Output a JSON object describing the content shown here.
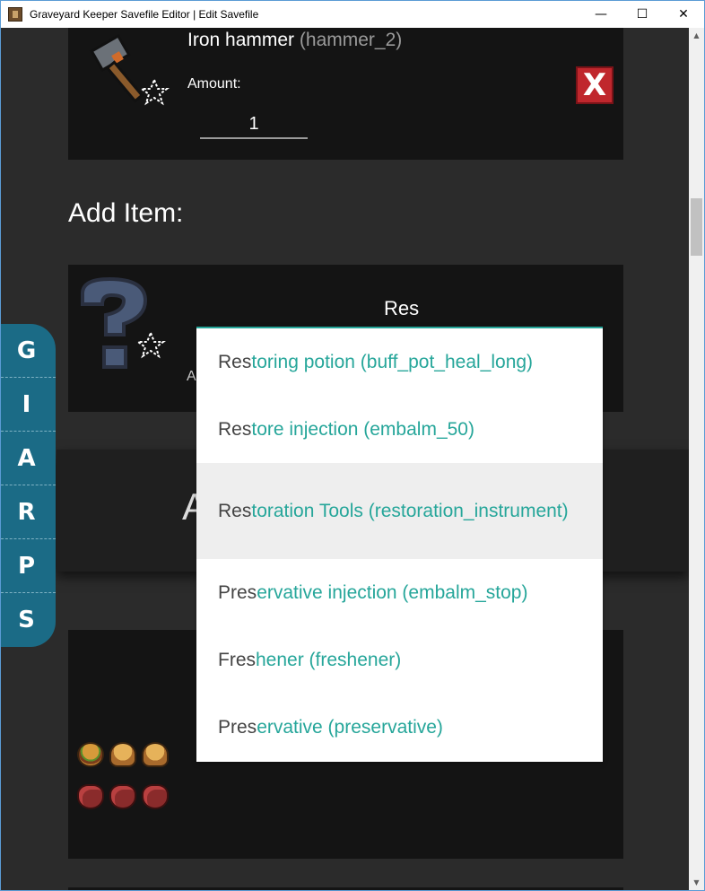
{
  "window": {
    "title": "Graveyard Keeper Savefile Editor | Edit Savefile",
    "controls": {
      "minimize": "—",
      "maximize": "☐",
      "close": "✕"
    }
  },
  "scrollbar": {
    "up": "▲",
    "down": "▼"
  },
  "item_card": {
    "name": "Iron hammer",
    "code": "(hammer_2)",
    "amount_label": "Amount:",
    "amount_value": "1",
    "delete_label": "X",
    "icon": "iron-hammer-icon"
  },
  "add_item": {
    "heading": "Add Item:",
    "search_value": "Res",
    "amount_label": "A",
    "icon": "unknown-item-question-icon"
  },
  "autocomplete": {
    "accent_color": "#26a69a",
    "items": [
      {
        "match": "Res",
        "rest": "toring potion (buff_pot_heal_long)"
      },
      {
        "match": "Res",
        "rest": "tore injection (embalm_50)"
      },
      {
        "match": "Res",
        "rest": "toration Tools (restoration_instrument)"
      },
      {
        "match": "Pres",
        "rest": "ervative injection (embalm_stop)"
      },
      {
        "match": "Fres",
        "rest": "hener (freshener)"
      },
      {
        "match": "Pres",
        "rest": "ervative (preservative)"
      }
    ],
    "active_index": 2
  },
  "band": {
    "letter": "A"
  },
  "side_nav": {
    "color": "#1b6b86",
    "items": [
      "G",
      "I",
      "A",
      "R",
      "P",
      "S"
    ]
  },
  "inventory": {
    "row1": [
      "burger-icon",
      "muffin-icon",
      "muffin-icon"
    ],
    "row2": [
      "organ-icon",
      "organ-icon",
      "organ-icon"
    ]
  }
}
